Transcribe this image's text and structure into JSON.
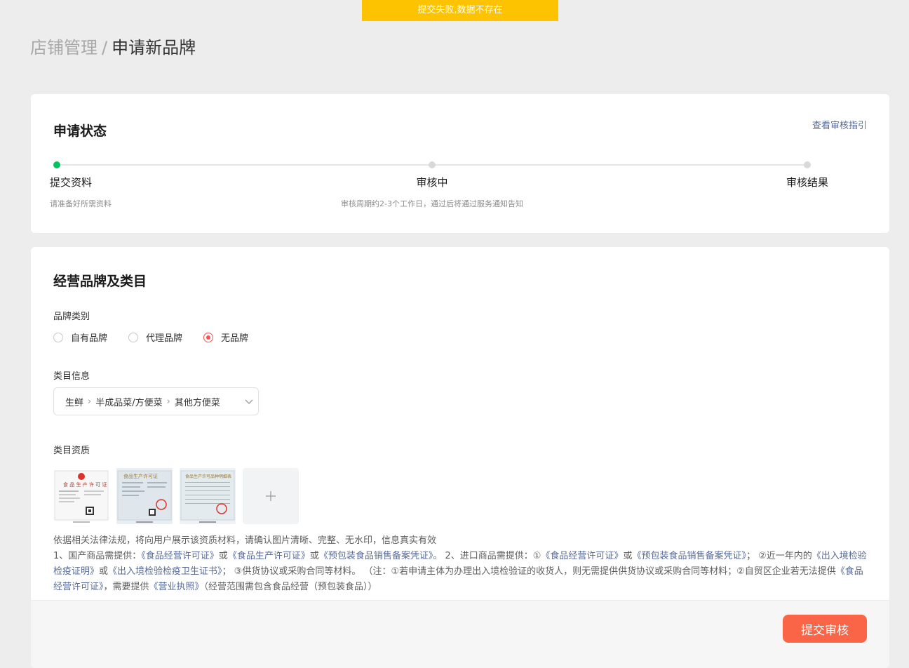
{
  "toast": {
    "message": "提交失败,数据不存在",
    "color": "#fdc300"
  },
  "breadcrumb": {
    "parent": "店铺管理",
    "separator": "/",
    "current": "申请新品牌"
  },
  "status_card": {
    "title": "申请状态",
    "guide_link": "查看审核指引",
    "steps": [
      {
        "label": "提交资料",
        "desc": "请准备好所需资料",
        "active": true
      },
      {
        "label": "审核中",
        "desc": "审核周期约2-3个工作日，通过后将通过服务通知告知",
        "active": false
      },
      {
        "label": "审核结果",
        "desc": "",
        "active": false
      }
    ],
    "active_color": "#07c160"
  },
  "brand_card": {
    "title": "经营品牌及类目",
    "brand_type_label": "品牌类别",
    "brand_options": [
      "自有品牌",
      "代理品牌",
      "无品牌"
    ],
    "brand_selected": "无品牌",
    "category_label": "类目信息",
    "category_path": [
      "生鲜",
      "半成品菜/方便菜",
      "其他方便菜"
    ],
    "qualification_label": "类目资质",
    "qualification_images": [
      "food-production-license",
      "food-production-license-copy",
      "food-production-product-list"
    ],
    "notice_line1": "依据相关法律法规，将向用户展示该资质材料，请确认图片清晰、完整、无水印，信息真实有效",
    "notice": {
      "p1": "1、国产商品需提供：",
      "l1": "《食品经营许可证》",
      "p2": "或",
      "l2": "《食品生产许可证》",
      "p3": "或",
      "l3": "《预包装食品销售备案凭证》",
      "p4": "。 2、进口商品需提供：①",
      "l4": "《食品经营许可证》",
      "p5": "或",
      "l5": "《预包装食品销售备案凭证》",
      "p6": "； ②近一年内的",
      "l6": "《出入境检验检疫证明》",
      "p7": "或",
      "l7": "《出入境检验检疫卫生证书》",
      "p8": "； ③供货协议或采购合同等材料。 （注：①若申请主体为办理出入境检验证的收货人，则无需提供供货协议或采购合同等材料；②自贸区企业若无法提供",
      "l8": "《食品经营许可证》",
      "p9": "，需要提供",
      "l9": "《营业执照》",
      "p10": "（经营范围需包含食品经营（预包装食品））"
    },
    "accent": "#fa5151",
    "link_color": "#576b95"
  },
  "footer": {
    "submit_label": "提交审核",
    "submit_color": "#fa6547"
  }
}
